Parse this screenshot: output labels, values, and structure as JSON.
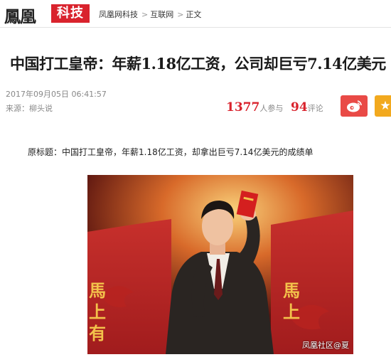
{
  "header": {
    "logo_text": "鳳凰",
    "logo_badge": "科技",
    "breadcrumb": [
      "凤凰网科技",
      "互联网",
      "正文"
    ],
    "breadcrumb_sep": ">"
  },
  "article": {
    "title": "中国打工皇帝：年薪1.18亿工资，公司却巨亏7.14亿美元",
    "time": "2017年09月05日 06:41:57",
    "source": "来源：柳头说",
    "join_count": "1377",
    "join_label": "人参与",
    "comment_count": "94",
    "comment_label": "评论",
    "original_title": "原标题：中国打工皇帝，年薪1.18亿工资，却拿出巨亏7.14亿美元的成绩单",
    "photo_watermark": "凤凰社区@夏",
    "photo_banner_left": "馬上有",
    "photo_banner_right": "馬上"
  },
  "icons": {
    "weibo": "weibo-icon",
    "favorite": "star-icon"
  },
  "colors": {
    "brand_red": "#d9232d",
    "weibo_red": "#e94a46",
    "fav_orange": "#f2a91e"
  }
}
